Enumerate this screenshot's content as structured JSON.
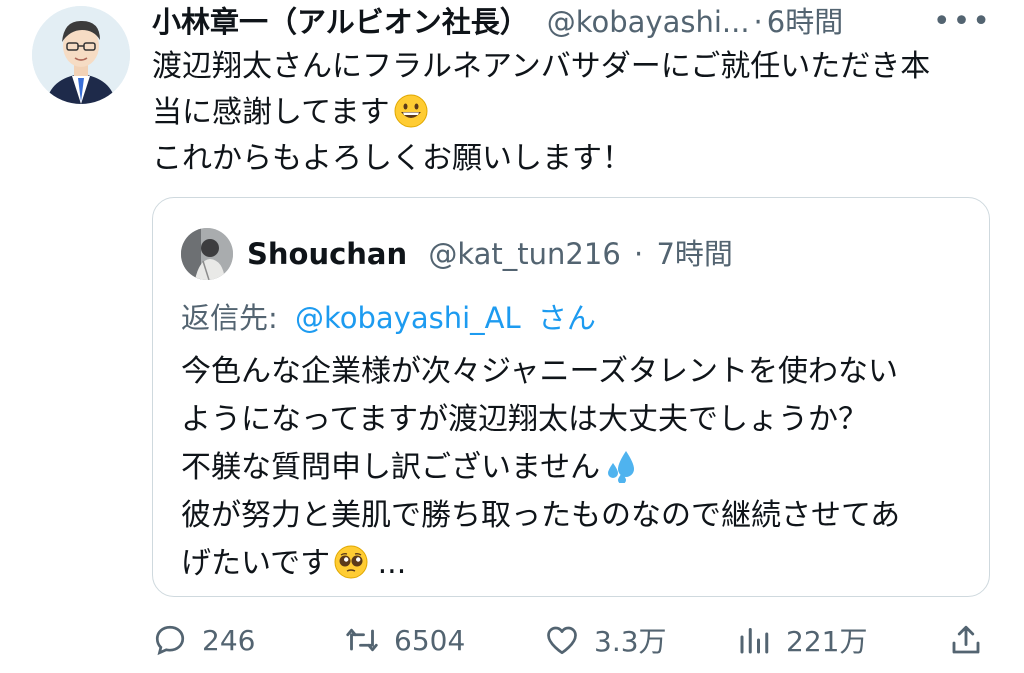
{
  "tweet": {
    "author_name": "小林章一（アルビオン社長）",
    "handle": "@kobayashi...",
    "separator": "·",
    "time": "6時間",
    "more_icon": "more-horizontal-icon",
    "text": "渡辺翔太さんにフラルネアンバサダーにご就任いただき本\n当に感謝してます",
    "text_emoji": "grinning-face-emoji",
    "text_line3": "これからもよろしくお願いします！"
  },
  "quote": {
    "author_name": "Shouchan",
    "handle": "@kat_tun216",
    "separator": "·",
    "time": "7時間",
    "reply_label": "返信先:",
    "reply_handle": "@kobayashi_AL",
    "reply_suffix": "さん",
    "text_part1": "今色んな企業様が次々ジャニーズタレントを使わない\nようになってますが渡辺翔太は大丈夫でしょうか？\n不躾な質問申し訳ございません",
    "emoji_sweat": "sweat-droplets-emoji",
    "text_part2": "彼が努力と美肌で勝ち取ったものなので継続させてあ\nげたいです",
    "emoji_pleading": "pleading-face-emoji",
    "text_tail": " ..."
  },
  "actions": {
    "reply": {
      "icon": "reply-icon",
      "count": "246"
    },
    "retweet": {
      "icon": "retweet-icon",
      "count": "6504"
    },
    "like": {
      "icon": "heart-icon",
      "count": "3.3万"
    },
    "views": {
      "icon": "analytics-icon",
      "count": "221万"
    },
    "share": {
      "icon": "share-icon"
    }
  },
  "colors": {
    "text": "#0f1419",
    "secondary": "#536471",
    "link": "#1d9bf0",
    "border": "#cfd9de"
  }
}
